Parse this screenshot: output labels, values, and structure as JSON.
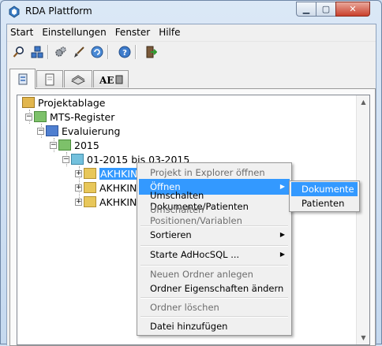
{
  "window": {
    "title": "RDA Plattform",
    "min_label": "▁",
    "max_label": "▢",
    "close_label": "✕"
  },
  "menubar": {
    "items": [
      "Start",
      "Einstellungen",
      "Fenster",
      "Hilfe"
    ]
  },
  "toolbar": {
    "buttons": [
      "search-icon",
      "network-icon",
      "gears-icon",
      "brush-icon",
      "refresh-icon",
      "help-icon",
      "exit-icon"
    ]
  },
  "tabs": {
    "items": [
      "tree-view-icon",
      "document-icon",
      "book-icon",
      "font-icon"
    ],
    "active_index": 0
  },
  "tree": {
    "nodes": [
      {
        "label": "Projektablage",
        "level": 0
      },
      {
        "label": "MTS-Register",
        "level": 1
      },
      {
        "label": "Evaluierung",
        "level": 2
      },
      {
        "label": "2015",
        "level": 3
      },
      {
        "label": "01-2015 bis 03-2015",
        "level": 4
      },
      {
        "label": "AKHKIN",
        "level": 5,
        "selected": true
      },
      {
        "label": "AKHKIN",
        "level": 5
      },
      {
        "label": "AKHKIN",
        "level": 5
      }
    ]
  },
  "context_menu": {
    "items": [
      {
        "label": "Projekt in Explorer öffnen",
        "disabled": true
      },
      {
        "label": "Öffnen",
        "highlighted": true,
        "submenu": true
      },
      {
        "label": "Umschalten Dokumente/Patienten"
      },
      {
        "label": "Umschalten Positionen/Variablen",
        "disabled": true
      },
      {
        "label": "Sortieren",
        "submenu": true
      },
      {
        "label": "Starte AdHocSQL ...",
        "submenu": true
      },
      {
        "label": "Neuen Ordner anlegen",
        "disabled": true
      },
      {
        "label": "Ordner Eigenschaften ändern"
      },
      {
        "label": "Ordner löschen",
        "disabled": true
      },
      {
        "label": "Datei hinzufügen"
      }
    ]
  },
  "submenu": {
    "items": [
      {
        "label": "Dokumente",
        "highlighted": true
      },
      {
        "label": "Patienten"
      }
    ]
  },
  "colors": {
    "highlight": "#3399ff",
    "disabled_text": "#6d6d6d"
  }
}
